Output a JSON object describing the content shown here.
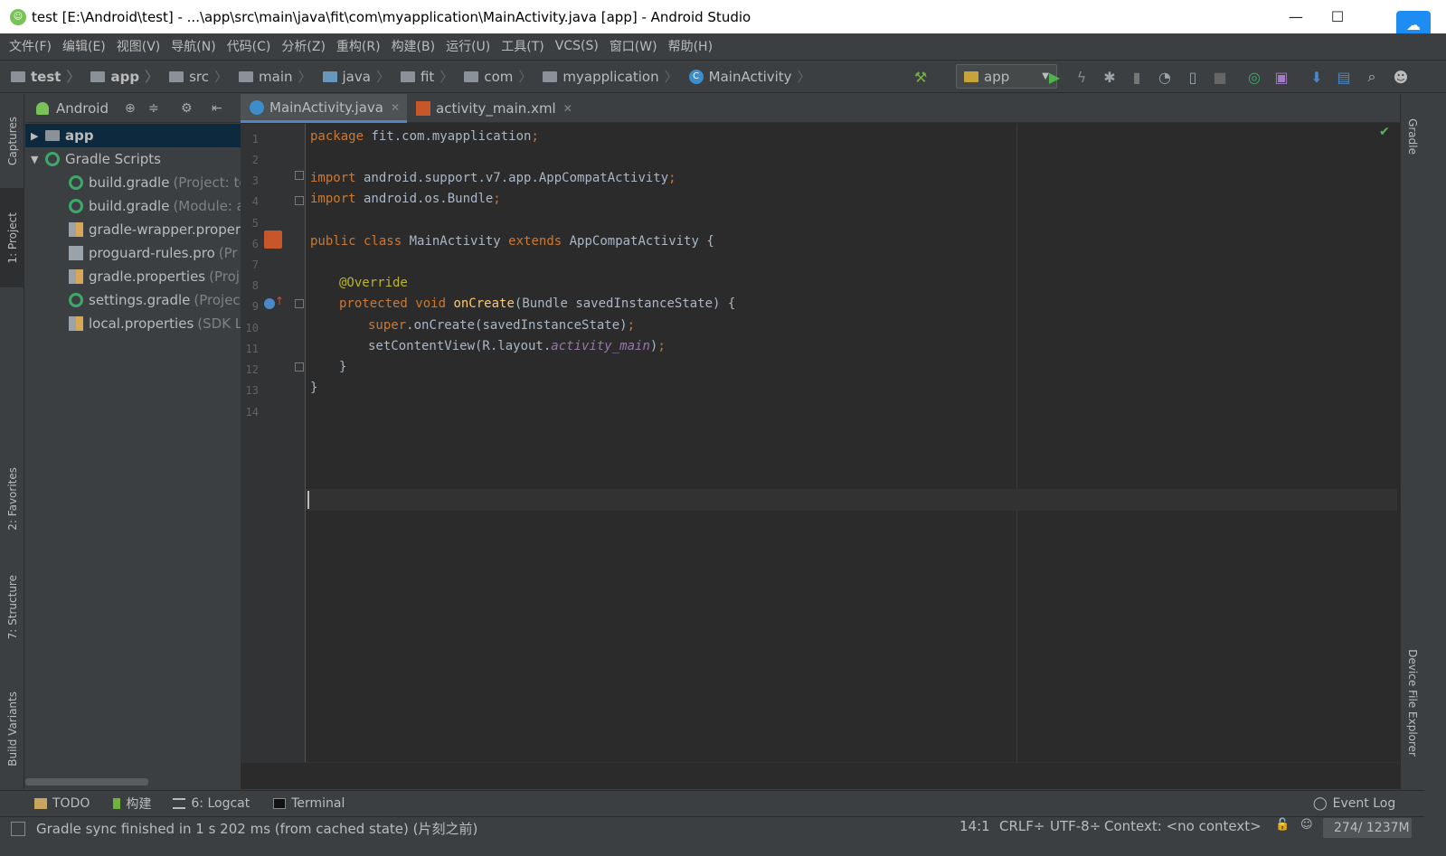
{
  "window": {
    "title": "test [E:\\Android\\test] - ...\\app\\src\\main\\java\\fit\\com\\myapplication\\MainActivity.java [app] - Android Studio",
    "minimize": "—",
    "maximize": "☐",
    "close": "✕"
  },
  "menu": [
    "文件(F)",
    "编辑(E)",
    "视图(V)",
    "导航(N)",
    "代码(C)",
    "分析(Z)",
    "重构(R)",
    "构建(B)",
    "运行(U)",
    "工具(T)",
    "VCS(S)",
    "窗口(W)",
    "帮助(H)"
  ],
  "breadcrumb": [
    "test",
    "app",
    "src",
    "main",
    "java",
    "fit",
    "com",
    "myapplication",
    "MainActivity"
  ],
  "run_config": "app",
  "left_tabs": {
    "captures": "Captures",
    "project": "1: Project",
    "favorites": "2: Favorites",
    "structure": "7: Structure",
    "build_variants": "Build Variants"
  },
  "right_tabs": {
    "gradle": "Gradle",
    "device_explorer": "Device File Explorer"
  },
  "project_view": {
    "mode": "Android",
    "tree": [
      {
        "name": "app",
        "hint": "",
        "type": "folder",
        "expanded": false
      },
      {
        "name": "Gradle Scripts",
        "hint": "",
        "type": "gradle",
        "expanded": true
      },
      {
        "name": "build.gradle",
        "hint": "(Project: te",
        "type": "gradle"
      },
      {
        "name": "build.gradle",
        "hint": "(Module: a",
        "type": "gradle"
      },
      {
        "name": "gradle-wrapper.proper",
        "hint": "",
        "type": "props"
      },
      {
        "name": "proguard-rules.pro",
        "hint": "(Pr",
        "type": "file"
      },
      {
        "name": "gradle.properties",
        "hint": "(Proj",
        "type": "props"
      },
      {
        "name": "settings.gradle",
        "hint": "(Projec",
        "type": "gradle"
      },
      {
        "name": "local.properties",
        "hint": "(SDK L",
        "type": "props"
      }
    ]
  },
  "editor": {
    "tabs": [
      {
        "label": "MainActivity.java",
        "active": true
      },
      {
        "label": "activity_main.xml",
        "active": false
      }
    ],
    "line_numbers": [
      "1",
      "2",
      "3",
      "4",
      "5",
      "6",
      "7",
      "8",
      "9",
      "10",
      "11",
      "12",
      "13",
      "14"
    ],
    "code": {
      "l1_kw": "package",
      "l1_rest": " fit.com.myapplication",
      "l3_kw": "import",
      "l3_rest": " android.support.v7.app.AppCompatActivity",
      "l4_kw": "import",
      "l4_rest": " android.os.Bundle",
      "l6_kw1": "public class",
      "l6_name": " MainActivity ",
      "l6_kw2": "extends",
      "l6_rest": " AppCompatActivity {",
      "l8_ann": "@Override",
      "l9_kw": "protected void",
      "l9_fn": "onCreate",
      "l9_rest": "(Bundle savedInstanceState) {",
      "l10_kw": "super",
      "l10_rest": ".onCreate(savedInstanceState)",
      "l11_a": "setContentView(R.layout.",
      "l11_field": "activity_main",
      "l11_b": ")",
      "l12": "}",
      "l13": "}",
      "semicolon": ";"
    }
  },
  "bottom_tools": [
    "TODO",
    "构建",
    "6: Logcat",
    "Terminal"
  ],
  "event_log": "Event Log",
  "status": {
    "message": "Gradle sync finished in 1 s 202 ms (from cached state) (片刻之前)",
    "position": "14:1",
    "line_sep": "CRLF÷",
    "encoding": "UTF-8÷",
    "context": "Context: <no context>",
    "memory_used": "274",
    "memory_total": " / 1237M"
  },
  "colors": {
    "editor_bg": "#2b2b2b",
    "panel_bg": "#3c3f41",
    "keyword": "#cc7832",
    "annotation": "#bbb529",
    "method": "#ffc66d",
    "field": "#9876aa",
    "text": "#a9b7c6"
  }
}
